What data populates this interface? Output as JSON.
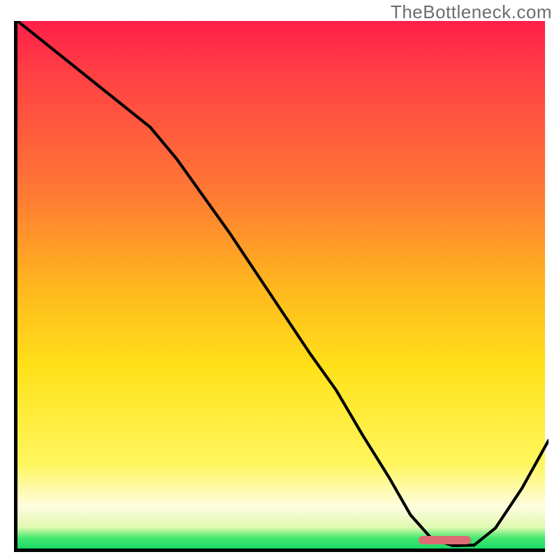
{
  "watermark": "TheBottleneck.com",
  "chart_data": {
    "type": "line",
    "title": "",
    "xlabel": "",
    "ylabel": "",
    "xlim": [
      0,
      100
    ],
    "ylim": [
      0,
      100
    ],
    "x": [
      0,
      5,
      10,
      15,
      20,
      25,
      30,
      35,
      40,
      45,
      50,
      55,
      60,
      65,
      70,
      74,
      78,
      82,
      86,
      90,
      95,
      100
    ],
    "values": [
      100,
      96,
      92,
      88,
      84,
      80,
      74,
      67,
      60,
      52.5,
      45,
      37.5,
      30.5,
      22,
      14,
      7,
      2.5,
      1.2,
      1.3,
      4.5,
      12,
      21
    ],
    "optimum_marker": {
      "x_start": 76,
      "x_end": 86,
      "y": 0.8
    },
    "gradient_colors": {
      "top": "#ff1f4a",
      "mid_upper": "#ff7a34",
      "mid": "#ffe21a",
      "mid_lower": "#fffde0",
      "bottom": "#18db67"
    }
  }
}
